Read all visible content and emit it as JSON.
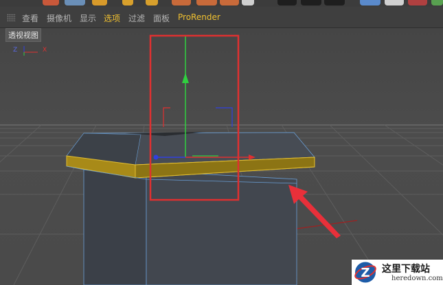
{
  "menubar": {
    "items": [
      {
        "label": "查看"
      },
      {
        "label": "摄像机"
      },
      {
        "label": "显示"
      },
      {
        "label": "选项"
      },
      {
        "label": "过滤"
      },
      {
        "label": "面板"
      },
      {
        "label": "ProRender"
      }
    ],
    "active_color": "#f0c030",
    "text_color": "#b4b4b4"
  },
  "viewport": {
    "label": "透视视图",
    "axis_labels": {
      "z": "Z",
      "x": "X"
    },
    "colors": {
      "selection_box": "#e03030",
      "y_axis": "#30d040",
      "x_axis": "#e03030",
      "z_axis": "#3040e0",
      "selected_polygon": "#a88a18",
      "object_body": "#3f444b",
      "annotation_arrow": "#e8303a"
    }
  },
  "watermark": {
    "title": "这里下载站",
    "url": "heredown.com",
    "logo_letter": "Z"
  }
}
